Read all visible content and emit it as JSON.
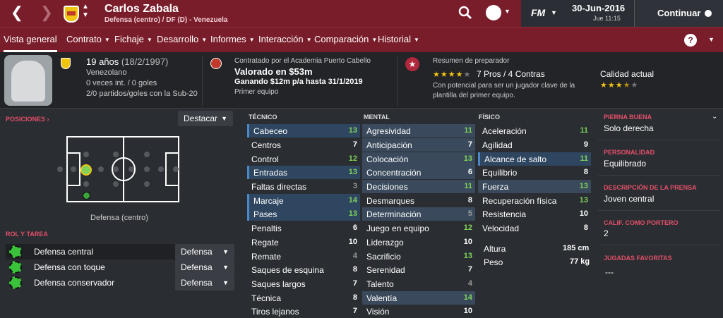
{
  "header": {
    "player_name": "Carlos Zabala",
    "player_sub": "Defensa (centro) / DF (D) - Venezuela",
    "date": "30-Jun-2016",
    "time": "Jue 11:15",
    "fm_label": "FM",
    "continue_label": "Continuar"
  },
  "tabs": [
    {
      "label": "Vista general"
    },
    {
      "label": "Contrato"
    },
    {
      "label": "Fichaje"
    },
    {
      "label": "Desarrollo"
    },
    {
      "label": "Informes"
    },
    {
      "label": "Interacción"
    },
    {
      "label": "Comparación"
    },
    {
      "label": "Historial"
    }
  ],
  "help_label": "?",
  "info": {
    "age": "19 años",
    "dob": "(18/2/1997)",
    "nationality": "Venezolano",
    "caps": "0 veces int. / 0 goles",
    "u20": "2/0 partidos/goles con la Sub-20",
    "contract_line": "Contratado por el Academia Puerto Cabello",
    "value": "Valorado en $53m",
    "wage": "Ganando $12m p/a hasta 31/1/2019",
    "squad": "Primer equipo",
    "coach_title": "Resumen de preparador",
    "pros_cons": "7 Pros / 4 Contras",
    "coach_text_1": "Con potencial para ser un jugador clave de la",
    "coach_text_2": "plantilla del primer equipo.",
    "quality_label": "Calidad actual",
    "potential_stars": 4,
    "quality_stars": 3.5
  },
  "positions": {
    "title": "POSICIONES",
    "dropdown": "Destacar",
    "position_label": "Defensa (centro)"
  },
  "roles": {
    "title": "ROL Y TAREA",
    "items": [
      {
        "role": "Defensa central",
        "duty": "Defensa"
      },
      {
        "role": "Defensa con toque",
        "duty": "Defensa"
      },
      {
        "role": "Defensa conservador",
        "duty": "Defensa"
      }
    ]
  },
  "technical": {
    "title": "TÉCNICO",
    "attrs": [
      {
        "name": "Cabeceo",
        "value": "13"
      },
      {
        "name": "Centros",
        "value": "7"
      },
      {
        "name": "Control",
        "value": "12"
      },
      {
        "name": "Entradas",
        "value": "13"
      },
      {
        "name": "Faltas directas",
        "value": "3"
      },
      {
        "name": "Marcaje",
        "value": "14"
      },
      {
        "name": "Pases",
        "value": "13"
      },
      {
        "name": "Penaltis",
        "value": "6"
      },
      {
        "name": "Regate",
        "value": "10"
      },
      {
        "name": "Remate",
        "value": "4"
      },
      {
        "name": "Saques de esquina",
        "value": "8"
      },
      {
        "name": "Saques largos",
        "value": "7"
      },
      {
        "name": "Técnica",
        "value": "8"
      },
      {
        "name": "Tiros lejanos",
        "value": "7"
      }
    ]
  },
  "mental": {
    "title": "MENTAL",
    "attrs": [
      {
        "name": "Agresividad",
        "value": "11"
      },
      {
        "name": "Anticipación",
        "value": "7"
      },
      {
        "name": "Colocación",
        "value": "13"
      },
      {
        "name": "Concentración",
        "value": "6"
      },
      {
        "name": "Decisiones",
        "value": "11"
      },
      {
        "name": "Desmarques",
        "value": "8"
      },
      {
        "name": "Determinación",
        "value": "5"
      },
      {
        "name": "Juego en equipo",
        "value": "12"
      },
      {
        "name": "Liderazgo",
        "value": "10"
      },
      {
        "name": "Sacrificio",
        "value": "13"
      },
      {
        "name": "Serenidad",
        "value": "7"
      },
      {
        "name": "Talento",
        "value": "4"
      },
      {
        "name": "Valentía",
        "value": "14"
      },
      {
        "name": "Visión",
        "value": "10"
      }
    ]
  },
  "physical": {
    "title": "FÍSICO",
    "attrs": [
      {
        "name": "Aceleración",
        "value": "11"
      },
      {
        "name": "Agilidad",
        "value": "9"
      },
      {
        "name": "Alcance de salto",
        "value": "11"
      },
      {
        "name": "Equilibrio",
        "value": "8"
      },
      {
        "name": "Fuerza",
        "value": "13"
      },
      {
        "name": "Recuperación física",
        "value": "13"
      },
      {
        "name": "Resistencia",
        "value": "10"
      },
      {
        "name": "Velocidad",
        "value": "8"
      }
    ],
    "height_label": "Altura",
    "height": "185 cm",
    "weight_label": "Peso",
    "weight": "77 kg"
  },
  "details": {
    "foot_title": "PIERNA BUENA",
    "foot": "Solo derecha",
    "personality_title": "PERSONALIDAD",
    "personality": "Equilibrado",
    "press_title": "DESCRIPCIÓN DE LA PRENSA",
    "press": "Joven central",
    "gk_title": "CALIF. COMO PORTERO",
    "gk": "2",
    "moves_title": "JUGADAS FAVORITAS",
    "moves": "---"
  },
  "colors": {
    "brand": "#7a1d2b",
    "accent": "#e3506a",
    "highlight": "#2f4660",
    "good": "#7fd25a"
  }
}
